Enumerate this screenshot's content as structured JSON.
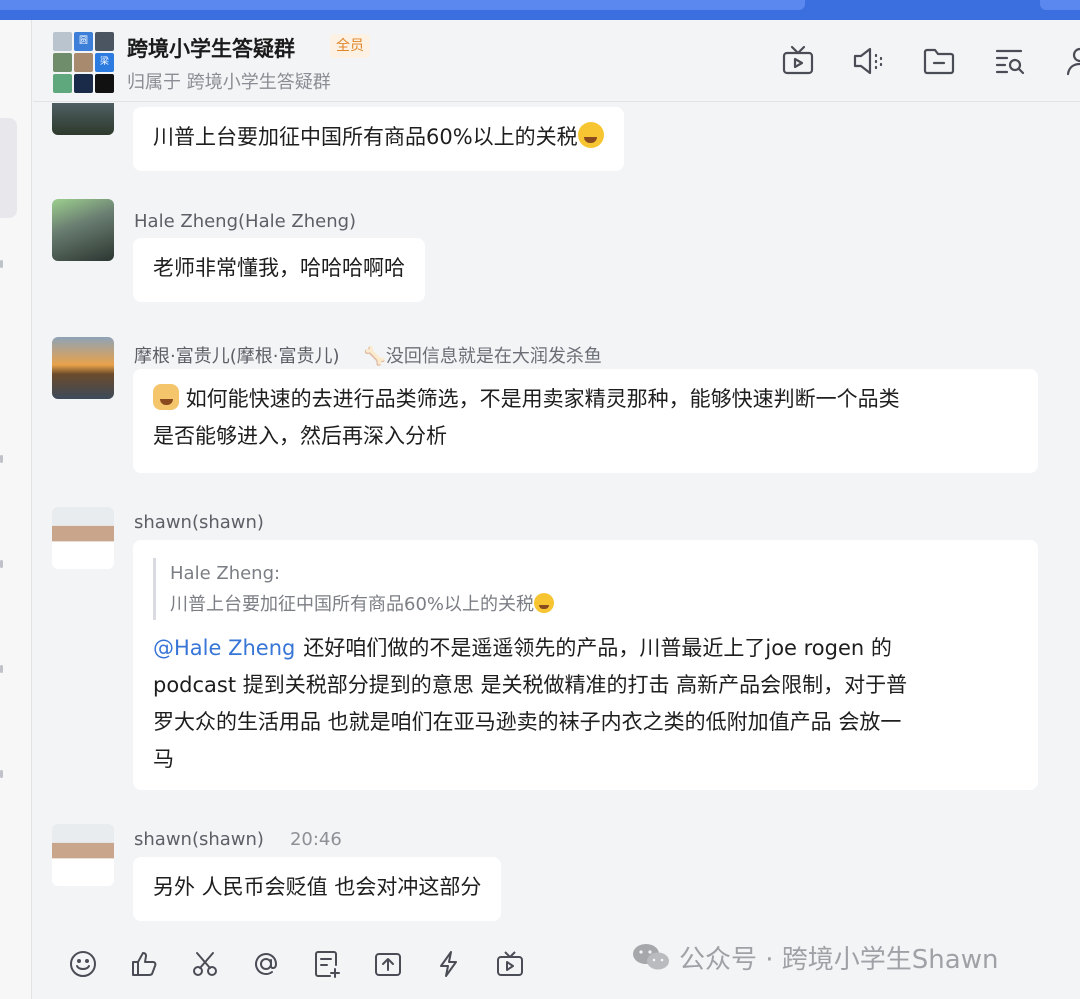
{
  "header": {
    "title": "跨境小学生答疑群",
    "badge": "全员",
    "subtitle": "归属于 跨境小学生答疑群",
    "avatar_chars": [
      "圆",
      "梁"
    ],
    "icons": [
      "tv-icon",
      "speaker-icon",
      "folder-icon",
      "search-list-icon",
      "user-icon"
    ]
  },
  "messages": [
    {
      "sender": "",
      "text": "川普上台要加征中国所有商品60%以上的关税",
      "emoji": "joy-emoji"
    },
    {
      "sender": "Hale Zheng(Hale Zheng)",
      "text": "老师非常懂我，哈哈哈啊哈"
    },
    {
      "sender": "摩根·富贵儿(摩根·富贵儿)",
      "status": "🦴没回信息就是在大润发杀鱼",
      "emoji": "thinking-emoji",
      "text_line1": "如何能快速的去进行品类筛选，不是用卖家精灵那种，能够快速判断一个品类",
      "text_line2": "是否能够进入，然后再深入分析"
    },
    {
      "sender": "shawn(shawn)",
      "quote_author": "Hale Zheng:",
      "quote_text": "川普上台要加征中国所有商品60%以上的关税",
      "mention": "@Hale Zheng",
      "text_line1": "还好咱们做的不是遥遥领先的产品，川普最近上了joe rogen 的",
      "text_line2": "podcast 提到关税部分提到的意思 是关税做精准的打击 高新产品会限制，对于普",
      "text_line3": "罗大众的生活用品 也就是咱们在亚马逊卖的袜子内衣之类的低附加值产品 会放一",
      "text_line4": "马"
    },
    {
      "sender": "shawn(shawn)",
      "time": "20:46",
      "text": "另外 人民币会贬值 也会对冲这部分"
    }
  ],
  "toolbar": {
    "icons": [
      "emoji-icon",
      "thumbs-up-icon",
      "scissors-icon",
      "at-icon",
      "add-doc-icon",
      "upload-icon",
      "lightning-icon",
      "video-icon"
    ],
    "watermark": "公众号 · 跨境小学生Shawn"
  },
  "colors": {
    "accent": "#3b6fe0",
    "mention": "#3775d6",
    "badge": "#e0862a",
    "background": "#f3f4f6"
  }
}
